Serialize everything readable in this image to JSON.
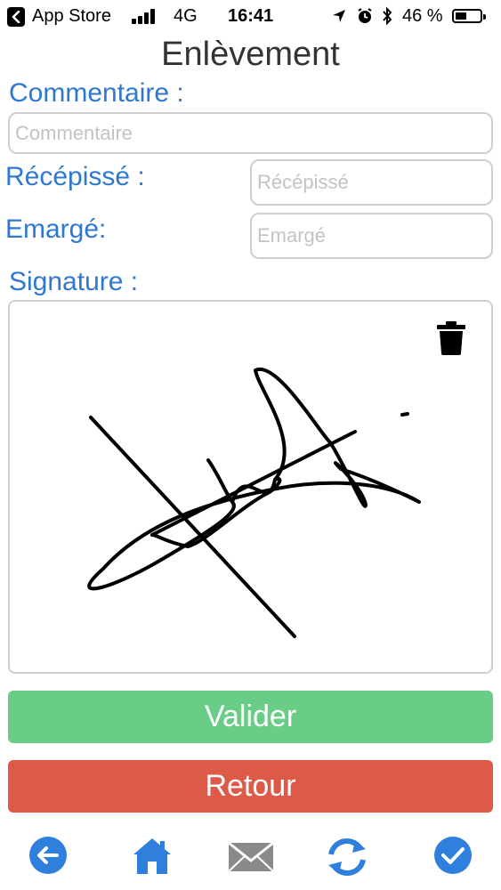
{
  "status_bar": {
    "carrier": "App Store",
    "network": "4G",
    "time": "16:41",
    "battery_text": "46 %",
    "battery_level": 0.46
  },
  "page": {
    "title": "Enlèvement"
  },
  "form": {
    "commentaire_label": "Commentaire :",
    "commentaire_placeholder": "Commentaire",
    "recepisse_label": "Récépissé :",
    "recepisse_placeholder": "Récépissé",
    "emarge_label": "Emargé:",
    "emarge_placeholder": "Emargé",
    "signature_label": "Signature :"
  },
  "buttons": {
    "valider": "Valider",
    "retour": "Retour"
  },
  "colors": {
    "label_blue": "#2f78d0",
    "valider_green": "#6acd87",
    "retour_red": "#dd5a49",
    "nav_blue": "#2f7fdc"
  },
  "bottom_nav": {
    "icons": [
      "back-arrow-icon",
      "home-icon",
      "mail-icon",
      "refresh-icon",
      "check-icon"
    ]
  }
}
